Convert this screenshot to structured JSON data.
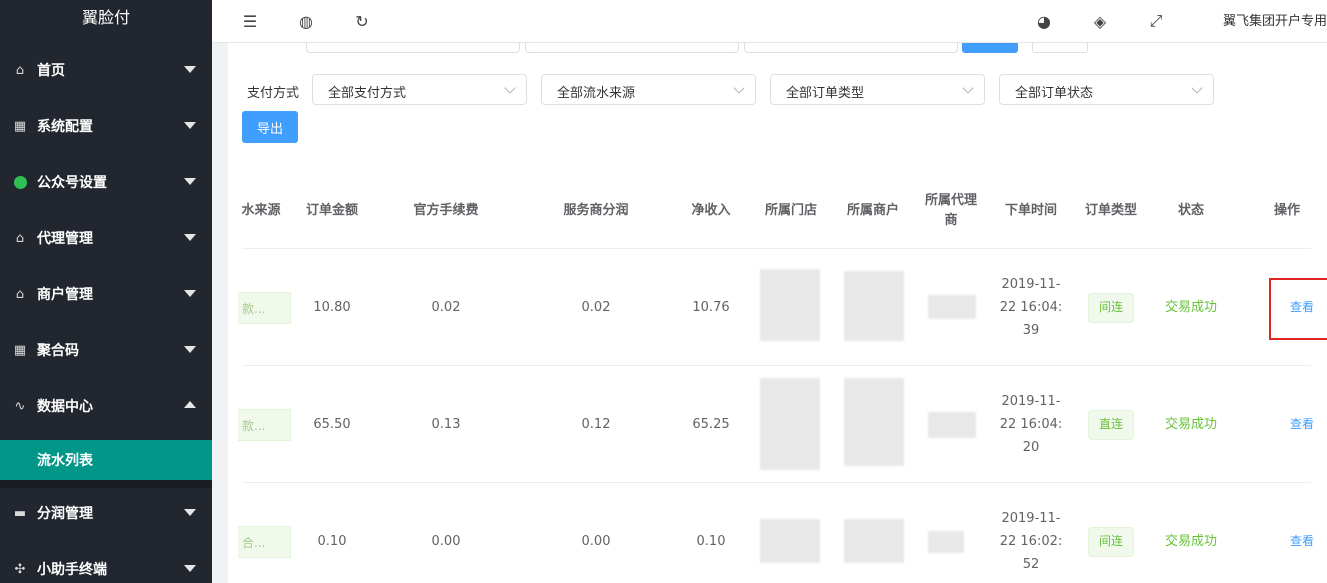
{
  "app": {
    "title": "翼脸付"
  },
  "sidebar": {
    "items": [
      {
        "label": "首页",
        "icon": "home-icon"
      },
      {
        "label": "系统配置",
        "icon": "grid-icon"
      },
      {
        "label": "公众号设置",
        "icon": "wechat-icon"
      },
      {
        "label": "代理管理",
        "icon": "home-icon"
      },
      {
        "label": "商户管理",
        "icon": "home-icon"
      },
      {
        "label": "聚合码",
        "icon": "grid-icon"
      },
      {
        "label": "数据中心",
        "icon": "pulse-icon"
      }
    ],
    "active_sub": "流水列表",
    "items_after": [
      {
        "label": "分润管理",
        "icon": "cash-icon"
      },
      {
        "label": "小助手终端",
        "icon": "fan-icon"
      }
    ]
  },
  "topbar": {
    "user": "翼飞集团开户专用",
    "icons": [
      "menu-fold-icon",
      "globe-icon",
      "refresh-icon",
      "palette-icon",
      "tag-icon",
      "fullscreen-icon"
    ]
  },
  "filters": {
    "label": "支付方式",
    "selects": [
      "全部支付方式",
      "全部流水来源",
      "全部订单类型",
      "全部订单状态"
    ],
    "export": "导出"
  },
  "table": {
    "headers": [
      "水来源",
      "订单金额",
      "官方手续费",
      "服务商分润",
      "净收入",
      "所属门店",
      "所属商户",
      "所属代理商",
      "下单时间",
      "订单类型",
      "状态",
      "操作"
    ],
    "rows": [
      {
        "source": "款...",
        "amount": "10.80",
        "fee": "0.02",
        "profit": "0.02",
        "net": "10.76",
        "time_a": "2019-11-",
        "time_b": "22 16:04:",
        "time_c": "39",
        "type": "间连",
        "status": "交易成功",
        "action": "查看"
      },
      {
        "source": "款...",
        "amount": "65.50",
        "fee": "0.13",
        "profit": "0.12",
        "net": "65.25",
        "time_a": "2019-11-",
        "time_b": "22 16:04:",
        "time_c": "20",
        "type": "直连",
        "status": "交易成功",
        "action": "查看"
      },
      {
        "source": "合...",
        "amount": "0.10",
        "fee": "0.00",
        "profit": "0.00",
        "net": "0.10",
        "time_a": "2019-11-",
        "time_b": "22 16:02:",
        "time_c": "52",
        "type": "间连",
        "status": "交易成功",
        "action": "查看"
      }
    ]
  }
}
